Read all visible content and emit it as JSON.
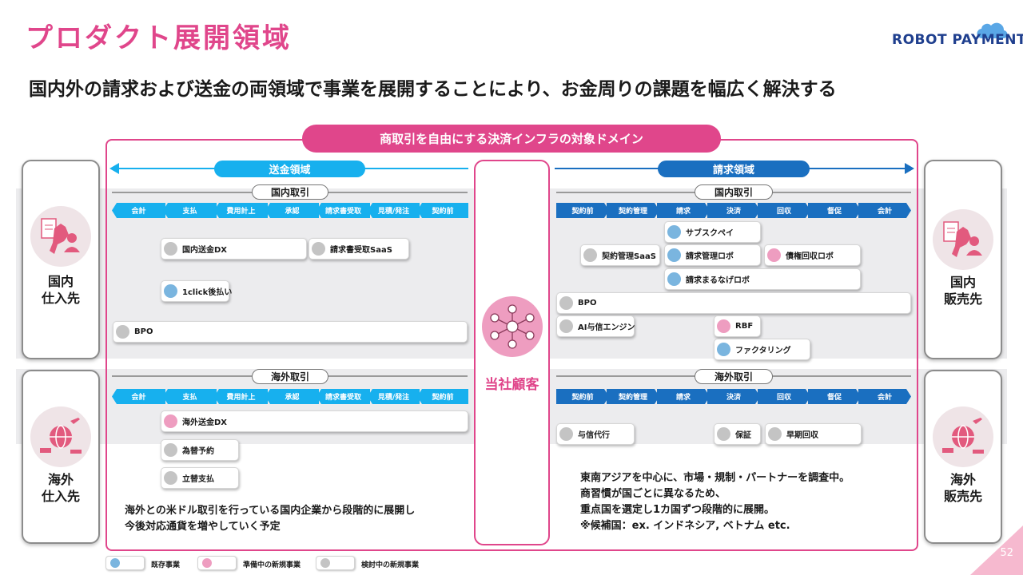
{
  "header": {
    "title": "プロダクト展開領域",
    "logo_text": "ROBOT PAYMENT",
    "subtitle": "国内外の請求および送金の両領域で事業を展開することにより、お金周りの課題を幅広く解決する"
  },
  "domain_label": "商取引を自由にする決済インフラの対象ドメイン",
  "areas": {
    "remittance": "送金領域",
    "billing": "請求領域"
  },
  "center_label": "当社顧客",
  "side": {
    "domestic_supplier": [
      "国内",
      "仕入先"
    ],
    "overseas_supplier": [
      "海外",
      "仕入先"
    ],
    "domestic_customer": [
      "国内",
      "販売先"
    ],
    "overseas_customer": [
      "海外",
      "販売先"
    ]
  },
  "trade": {
    "domestic": "国内取引",
    "overseas": "海外取引"
  },
  "left_steps": [
    "会計",
    "支払",
    "費用計上",
    "承認",
    "請求書受取",
    "見積/発注",
    "契約前"
  ],
  "right_steps": [
    "契約前",
    "契約管理",
    "請求",
    "決済",
    "回収",
    "督促",
    "会計"
  ],
  "services": {
    "remit_dx": "国内送金DX",
    "invoice_receipt": "請求書受取SaaS",
    "oneclick": "1click後払い",
    "bpo_left": "BPO",
    "subscpay": "サブスクペイ",
    "contract_saas": "契約管理SaaS",
    "billing_robo": "請求管理ロボ",
    "debt_robo": "債権回収ロボ",
    "seikyu_marunage": "請求まるなげロボ",
    "bpo_right": "BPO",
    "ai_credit": "AI与信エンジン",
    "rbf": "RBF",
    "factoring": "ファクタリング",
    "overseas_remit": "海外送金DX",
    "fx_reserve": "為替予約",
    "advance_pay": "立替支払",
    "credit_agency": "与信代行",
    "guarantee": "保証",
    "early_collect": "早期回収"
  },
  "notes": {
    "left": [
      "海外との米ドル取引を行っている国内企業から段階的に展開し",
      "今後対応通貨を増やしていく予定"
    ],
    "right": [
      "東南アジアを中心に、市場・規制・パートナーを調査中。",
      "商習慣が国ごとに異なるため、",
      "重点国を選定し1カ国ずつ段階的に展開。",
      "※候補国：ex. インドネシア, ベトナム etc."
    ]
  },
  "legend": {
    "existing": "既存事業",
    "preparing": "準備中の新規事業",
    "considering": "検討中の新規事業"
  },
  "page_number": "52",
  "colors": {
    "accent": "#e0468b",
    "remittance": "#17b0ee",
    "billing": "#1a6fc0",
    "existing": "#7ab5df",
    "preparing": "#ee9dc0",
    "considering": "#c4c4c4"
  }
}
